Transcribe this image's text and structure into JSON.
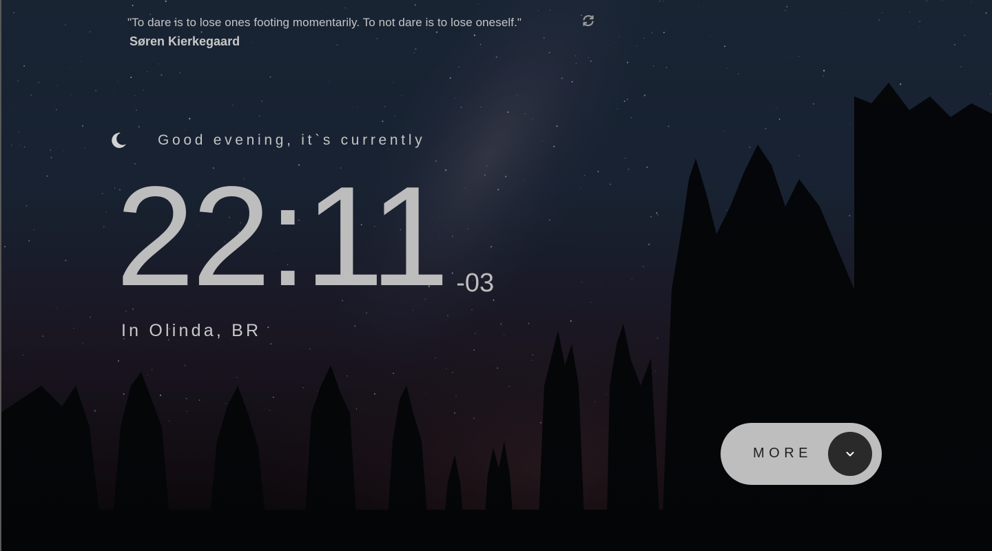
{
  "quote": {
    "text": "\"To dare is to lose ones footing momentarily. To not dare is to lose oneself.\"",
    "author": "Søren Kierkegaard"
  },
  "greeting": {
    "icon": "moon-icon",
    "text": "Good evening, it`s currently"
  },
  "clock": {
    "time": "22:11",
    "timezone": "-03"
  },
  "location": {
    "text": "In Olinda, BR"
  },
  "more_button": {
    "label": "MORE",
    "icon": "chevron-down-icon"
  },
  "colors": {
    "sky_top": "#2a3f5a",
    "sky_bottom": "#3a3045",
    "text": "#c6c6c6",
    "button_bg": "#bebebe",
    "button_toggle": "#2a2a2a"
  }
}
